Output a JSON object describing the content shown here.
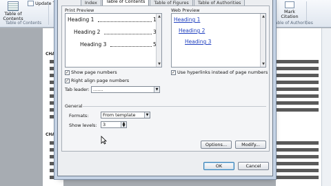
{
  "ribbon": {
    "toc_label": "Table of\nContents",
    "update_label": "Update Tab",
    "group_toc": "Table of Contents",
    "group_citation": "Table of Authorities",
    "mark_label": "Mark\nCitation",
    "small_left": "",
    "small_right": ""
  },
  "document": {
    "chapter_label_1": "CHA",
    "chapter_label_2": "CHA"
  },
  "dialog": {
    "tabs": [
      "Index",
      "Table of Contents",
      "Table of Figures",
      "Table of Authorities"
    ],
    "active_tab": 1,
    "print_preview_label": "Print Preview",
    "web_preview_label": "Web Preview",
    "print_preview": [
      {
        "text": "Heading 1",
        "page": "1"
      },
      {
        "text": "Heading 2",
        "page": "3"
      },
      {
        "text": "Heading 3",
        "page": "5"
      }
    ],
    "web_preview": [
      "Heading 1",
      "Heading 2",
      "Heading 3"
    ],
    "show_page_numbers": "Show page numbers",
    "right_align": "Right align page numbers",
    "tab_leader_label": "Tab leader:",
    "tab_leader_value": ".......",
    "use_hyperlinks": "Use hyperlinks instead of page numbers",
    "general_label": "General",
    "formats_label": "Formats:",
    "formats_value": "From template",
    "show_levels_label": "Show levels:",
    "show_levels_value": "3",
    "options_button": "Options...",
    "modify_button": "Modify...",
    "ok_button": "OK",
    "cancel_button": "Cancel"
  },
  "colors": {
    "link": "#1f3fbf",
    "dialog_bg": "#eceef1",
    "default_button_border": "#3c7fb1"
  }
}
